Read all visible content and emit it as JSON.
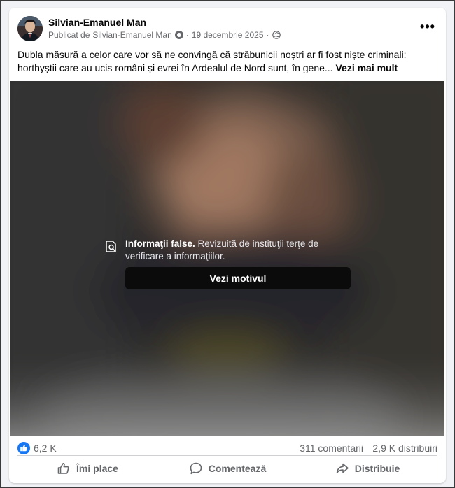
{
  "post": {
    "author": "Silvian-Emanuel Man",
    "meta_prefix": "Publicat de",
    "meta_author": "Silvian-Emanuel Man",
    "separator": "·",
    "date": "19 decembrie 2025",
    "privacy_separator": "·",
    "more_label": "•••",
    "text_line1": "Dubla măsură a celor care vor să ne convingă că străbunicii noștri ar fi fost niște criminali:",
    "text_line2": "horthyștii care au ucis români și evrei în Ardealul de Nord sunt, în gene...",
    "see_more": "Vezi mai mult"
  },
  "warning": {
    "title": "Informaţii false.",
    "description": " Revizuită de instituţii terţe de verificare a informaţiilor.",
    "button": "Vezi motivul",
    "icon": "fact-check-icon"
  },
  "stats": {
    "likes": "6,2 K",
    "comments": "311 comentarii",
    "shares": "2,9 K distribuiri"
  },
  "actions": {
    "like": "Îmi place",
    "comment": "Comentează",
    "share": "Distribuie"
  },
  "colors": {
    "brand": "#1877f2",
    "secondary_text": "#65676b",
    "overlay_button": "#0b0b0b"
  }
}
